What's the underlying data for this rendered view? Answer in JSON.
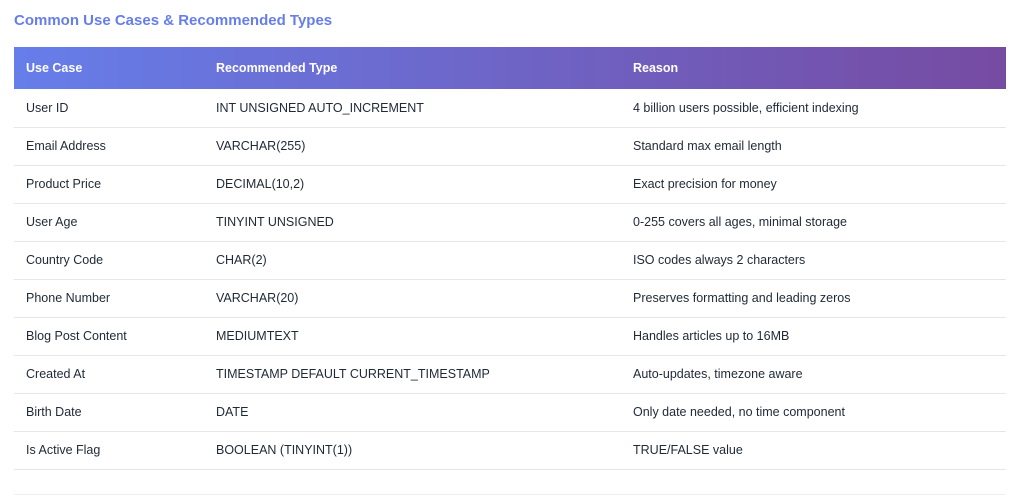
{
  "section": {
    "title": "Common Use Cases & Recommended Types"
  },
  "table": {
    "headers": [
      "Use Case",
      "Recommended Type",
      "Reason"
    ],
    "rows": [
      [
        "User ID",
        "INT UNSIGNED AUTO_INCREMENT",
        "4 billion users possible, efficient indexing"
      ],
      [
        "Email Address",
        "VARCHAR(255)",
        "Standard max email length"
      ],
      [
        "Product Price",
        "DECIMAL(10,2)",
        "Exact precision for money"
      ],
      [
        "User Age",
        "TINYINT UNSIGNED",
        "0-255 covers all ages, minimal storage"
      ],
      [
        "Country Code",
        "CHAR(2)",
        "ISO codes always 2 characters"
      ],
      [
        "Phone Number",
        "VARCHAR(20)",
        "Preserves formatting and leading zeros"
      ],
      [
        "Blog Post Content",
        "MEDIUMTEXT",
        "Handles articles up to 16MB"
      ],
      [
        "Created At",
        "TIMESTAMP DEFAULT CURRENT_TIMESTAMP",
        "Auto-updates, timezone aware"
      ],
      [
        "Birth Date",
        "DATE",
        "Only date needed, no time component"
      ],
      [
        "Is Active Flag",
        "BOOLEAN (TINYINT(1))",
        "TRUE/FALSE value"
      ]
    ]
  },
  "colors": {
    "title": "#667eea",
    "header_gradient_start": "#667eea",
    "header_gradient_end": "#764ba2",
    "row_divider": "#e5e7eb"
  }
}
